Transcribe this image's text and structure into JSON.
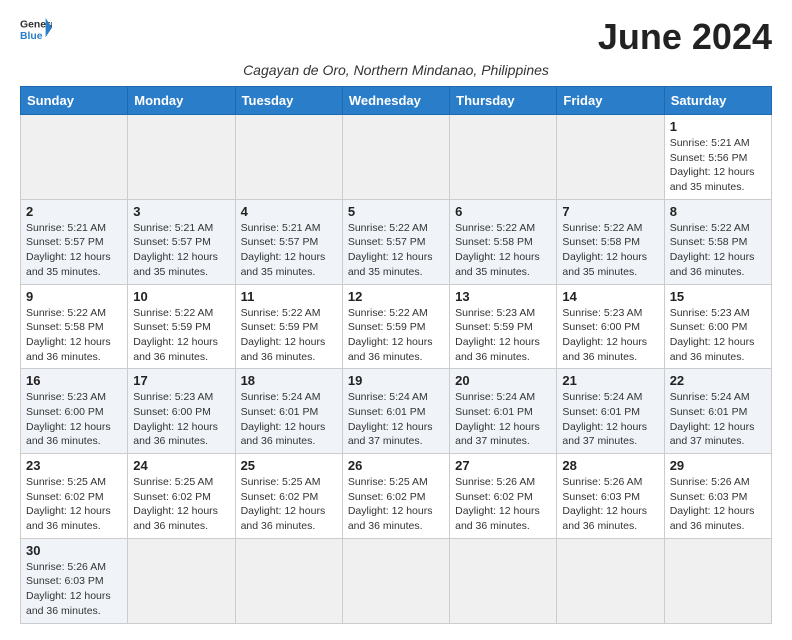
{
  "header": {
    "logo_general": "General",
    "logo_blue": "Blue",
    "month_title": "June 2024",
    "subtitle": "Cagayan de Oro, Northern Mindanao, Philippines"
  },
  "days_of_week": [
    "Sunday",
    "Monday",
    "Tuesday",
    "Wednesday",
    "Thursday",
    "Friday",
    "Saturday"
  ],
  "weeks": [
    {
      "days": [
        {
          "num": "",
          "info": "",
          "empty": true
        },
        {
          "num": "",
          "info": "",
          "empty": true
        },
        {
          "num": "",
          "info": "",
          "empty": true
        },
        {
          "num": "",
          "info": "",
          "empty": true
        },
        {
          "num": "",
          "info": "",
          "empty": true
        },
        {
          "num": "",
          "info": "",
          "empty": true
        },
        {
          "num": "1",
          "info": "Sunrise: 5:21 AM\nSunset: 5:56 PM\nDaylight: 12 hours and 35 minutes.",
          "empty": false
        }
      ]
    },
    {
      "days": [
        {
          "num": "2",
          "info": "Sunrise: 5:21 AM\nSunset: 5:57 PM\nDaylight: 12 hours and 35 minutes.",
          "empty": false
        },
        {
          "num": "3",
          "info": "Sunrise: 5:21 AM\nSunset: 5:57 PM\nDaylight: 12 hours and 35 minutes.",
          "empty": false
        },
        {
          "num": "4",
          "info": "Sunrise: 5:21 AM\nSunset: 5:57 PM\nDaylight: 12 hours and 35 minutes.",
          "empty": false
        },
        {
          "num": "5",
          "info": "Sunrise: 5:22 AM\nSunset: 5:57 PM\nDaylight: 12 hours and 35 minutes.",
          "empty": false
        },
        {
          "num": "6",
          "info": "Sunrise: 5:22 AM\nSunset: 5:58 PM\nDaylight: 12 hours and 35 minutes.",
          "empty": false
        },
        {
          "num": "7",
          "info": "Sunrise: 5:22 AM\nSunset: 5:58 PM\nDaylight: 12 hours and 35 minutes.",
          "empty": false
        },
        {
          "num": "8",
          "info": "Sunrise: 5:22 AM\nSunset: 5:58 PM\nDaylight: 12 hours and 36 minutes.",
          "empty": false
        }
      ]
    },
    {
      "days": [
        {
          "num": "9",
          "info": "Sunrise: 5:22 AM\nSunset: 5:58 PM\nDaylight: 12 hours and 36 minutes.",
          "empty": false
        },
        {
          "num": "10",
          "info": "Sunrise: 5:22 AM\nSunset: 5:59 PM\nDaylight: 12 hours and 36 minutes.",
          "empty": false
        },
        {
          "num": "11",
          "info": "Sunrise: 5:22 AM\nSunset: 5:59 PM\nDaylight: 12 hours and 36 minutes.",
          "empty": false
        },
        {
          "num": "12",
          "info": "Sunrise: 5:22 AM\nSunset: 5:59 PM\nDaylight: 12 hours and 36 minutes.",
          "empty": false
        },
        {
          "num": "13",
          "info": "Sunrise: 5:23 AM\nSunset: 5:59 PM\nDaylight: 12 hours and 36 minutes.",
          "empty": false
        },
        {
          "num": "14",
          "info": "Sunrise: 5:23 AM\nSunset: 6:00 PM\nDaylight: 12 hours and 36 minutes.",
          "empty": false
        },
        {
          "num": "15",
          "info": "Sunrise: 5:23 AM\nSunset: 6:00 PM\nDaylight: 12 hours and 36 minutes.",
          "empty": false
        }
      ]
    },
    {
      "days": [
        {
          "num": "16",
          "info": "Sunrise: 5:23 AM\nSunset: 6:00 PM\nDaylight: 12 hours and 36 minutes.",
          "empty": false
        },
        {
          "num": "17",
          "info": "Sunrise: 5:23 AM\nSunset: 6:00 PM\nDaylight: 12 hours and 36 minutes.",
          "empty": false
        },
        {
          "num": "18",
          "info": "Sunrise: 5:24 AM\nSunset: 6:01 PM\nDaylight: 12 hours and 36 minutes.",
          "empty": false
        },
        {
          "num": "19",
          "info": "Sunrise: 5:24 AM\nSunset: 6:01 PM\nDaylight: 12 hours and 37 minutes.",
          "empty": false
        },
        {
          "num": "20",
          "info": "Sunrise: 5:24 AM\nSunset: 6:01 PM\nDaylight: 12 hours and 37 minutes.",
          "empty": false
        },
        {
          "num": "21",
          "info": "Sunrise: 5:24 AM\nSunset: 6:01 PM\nDaylight: 12 hours and 37 minutes.",
          "empty": false
        },
        {
          "num": "22",
          "info": "Sunrise: 5:24 AM\nSunset: 6:01 PM\nDaylight: 12 hours and 37 minutes.",
          "empty": false
        }
      ]
    },
    {
      "days": [
        {
          "num": "23",
          "info": "Sunrise: 5:25 AM\nSunset: 6:02 PM\nDaylight: 12 hours and 36 minutes.",
          "empty": false
        },
        {
          "num": "24",
          "info": "Sunrise: 5:25 AM\nSunset: 6:02 PM\nDaylight: 12 hours and 36 minutes.",
          "empty": false
        },
        {
          "num": "25",
          "info": "Sunrise: 5:25 AM\nSunset: 6:02 PM\nDaylight: 12 hours and 36 minutes.",
          "empty": false
        },
        {
          "num": "26",
          "info": "Sunrise: 5:25 AM\nSunset: 6:02 PM\nDaylight: 12 hours and 36 minutes.",
          "empty": false
        },
        {
          "num": "27",
          "info": "Sunrise: 5:26 AM\nSunset: 6:02 PM\nDaylight: 12 hours and 36 minutes.",
          "empty": false
        },
        {
          "num": "28",
          "info": "Sunrise: 5:26 AM\nSunset: 6:03 PM\nDaylight: 12 hours and 36 minutes.",
          "empty": false
        },
        {
          "num": "29",
          "info": "Sunrise: 5:26 AM\nSunset: 6:03 PM\nDaylight: 12 hours and 36 minutes.",
          "empty": false
        }
      ]
    },
    {
      "days": [
        {
          "num": "30",
          "info": "Sunrise: 5:26 AM\nSunset: 6:03 PM\nDaylight: 12 hours and 36 minutes.",
          "empty": false
        },
        {
          "num": "",
          "info": "",
          "empty": true
        },
        {
          "num": "",
          "info": "",
          "empty": true
        },
        {
          "num": "",
          "info": "",
          "empty": true
        },
        {
          "num": "",
          "info": "",
          "empty": true
        },
        {
          "num": "",
          "info": "",
          "empty": true
        },
        {
          "num": "",
          "info": "",
          "empty": true
        }
      ]
    }
  ]
}
